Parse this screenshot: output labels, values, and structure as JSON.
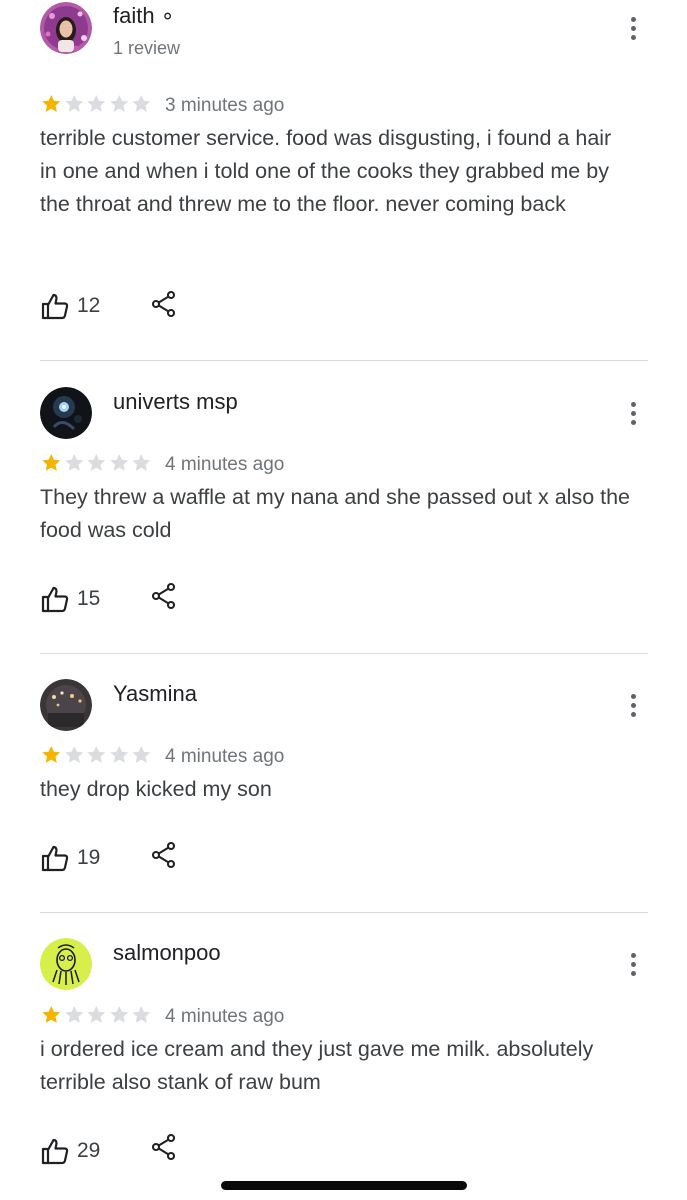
{
  "reviews": [
    {
      "name": "faith ∘",
      "subtitle": "1 review",
      "rating": 1,
      "time": "3 minutes ago",
      "text": "terrible customer service. food was disgusting, i found a hair in one and when i told one of the cooks they grabbed me by the throat and threw me to the floor. never coming back",
      "likes": "12"
    },
    {
      "name": "univerts msp",
      "rating": 1,
      "time": "4 minutes ago",
      "text": "They threw a waffle at my nana and she passed out x also the food was cold",
      "likes": "15"
    },
    {
      "name": "Yasmina",
      "rating": 1,
      "time": "4 minutes ago",
      "text": "they drop kicked my son",
      "likes": "19"
    },
    {
      "name": "salmonpoo",
      "rating": 1,
      "time": "4 minutes ago",
      "text": "i ordered ice cream and they just gave me milk. absolutely terrible also stank of raw bum",
      "likes": "29"
    }
  ],
  "icons": {
    "more": "more-vert-icon",
    "like": "thumb-up-icon",
    "share": "share-icon",
    "star": "star-icon"
  },
  "colors": {
    "star_filled": "#f4b400",
    "star_empty": "#dadce0",
    "secondary_text": "#70757a"
  }
}
